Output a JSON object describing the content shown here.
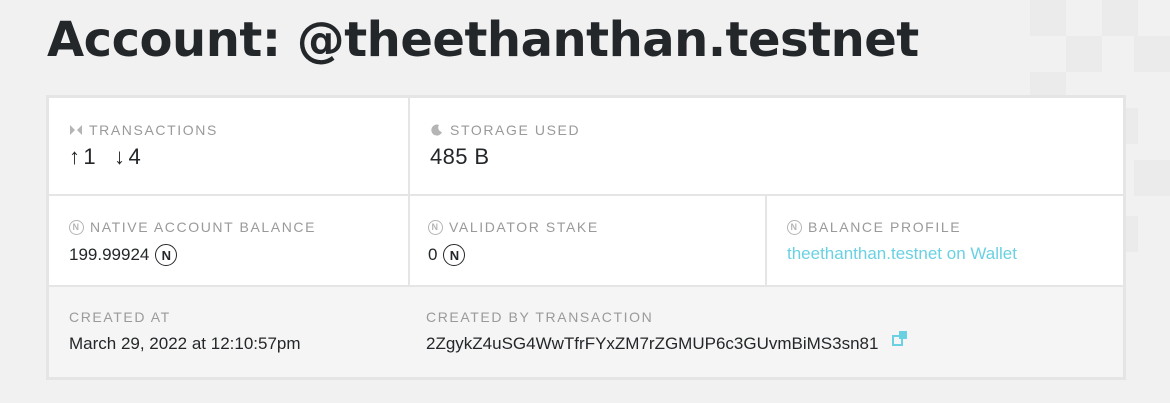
{
  "header": {
    "title": "Account: @theethanthan.testnet"
  },
  "transactions": {
    "label": "TRANSACTIONS",
    "outgoing_arrow": "↑",
    "outgoing": "1",
    "incoming_arrow": "↓",
    "incoming": "4",
    "icon": "transfer-icon"
  },
  "storage": {
    "label": "STORAGE USED",
    "value": "485 B",
    "icon": "moon-icon"
  },
  "native_balance": {
    "label": "NATIVE ACCOUNT BALANCE",
    "value": "199.99924",
    "icon": "near-icon"
  },
  "validator_stake": {
    "label": "VALIDATOR STAKE",
    "value": "0",
    "icon": "near-icon"
  },
  "balance_profile": {
    "label": "BALANCE PROFILE",
    "link_text": "theethanthan.testnet on Wallet",
    "icon": "near-icon"
  },
  "created_at": {
    "label": "CREATED AT",
    "value": "March 29, 2022 at 12:10:57pm"
  },
  "created_by": {
    "label": "CREATED BY TRANSACTION",
    "value": "2ZgykZ4uSG4WwTfrFYxZM7rZGMUP6c3GUvmBiMS3sn81",
    "icon": "external-link-icon"
  },
  "near_symbol": "N",
  "colors": {
    "accent": "#6ad1e3",
    "text": "#24272a",
    "muted": "#9a9a9a",
    "border": "#e5e5e5"
  }
}
